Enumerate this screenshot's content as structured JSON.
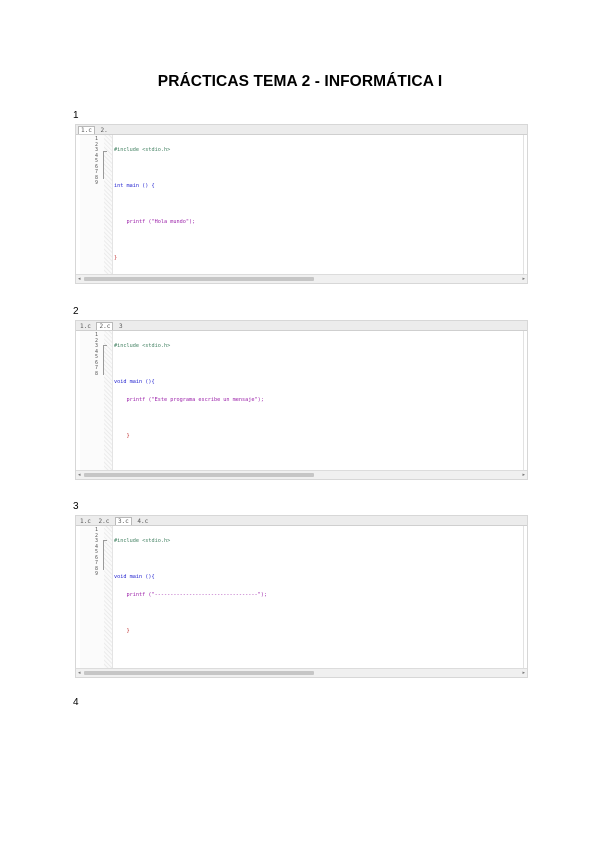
{
  "document": {
    "title": "PRÁCTICAS TEMA 2 - INFORMÁTICA I"
  },
  "sections": [
    {
      "number": "1",
      "tabs": [
        "1.c",
        "2."
      ],
      "line_numbers": [
        "1",
        "2",
        "3",
        "4",
        "5",
        "6",
        "7",
        "8",
        "9"
      ],
      "code": [
        "#include <stdio.h>",
        "",
        "int main () {",
        "",
        "    printf (\"Hola mundo\");",
        "",
        "}",
        ""
      ]
    },
    {
      "number": "2",
      "tabs": [
        "1.c",
        "2.c",
        "3"
      ],
      "line_numbers": [
        "1",
        "2",
        "3",
        "4",
        "5",
        "6",
        "7",
        "8"
      ],
      "code": [
        "#include <stdio.h>",
        "",
        "void main (){",
        "    printf (\"Este programa escribe un mensaje\");",
        "",
        "    }"
      ]
    },
    {
      "number": "3",
      "tabs": [
        "1.c",
        "2.c",
        "3.c",
        "4.c"
      ],
      "line_numbers": [
        "1",
        "2",
        "3",
        "4",
        "5",
        "6",
        "7",
        "8",
        "9"
      ],
      "code": [
        "#include <stdio.h>",
        "",
        "void main (){",
        "    printf (\"---------------------------------\");",
        "",
        "    }"
      ]
    },
    {
      "number": "4"
    }
  ]
}
